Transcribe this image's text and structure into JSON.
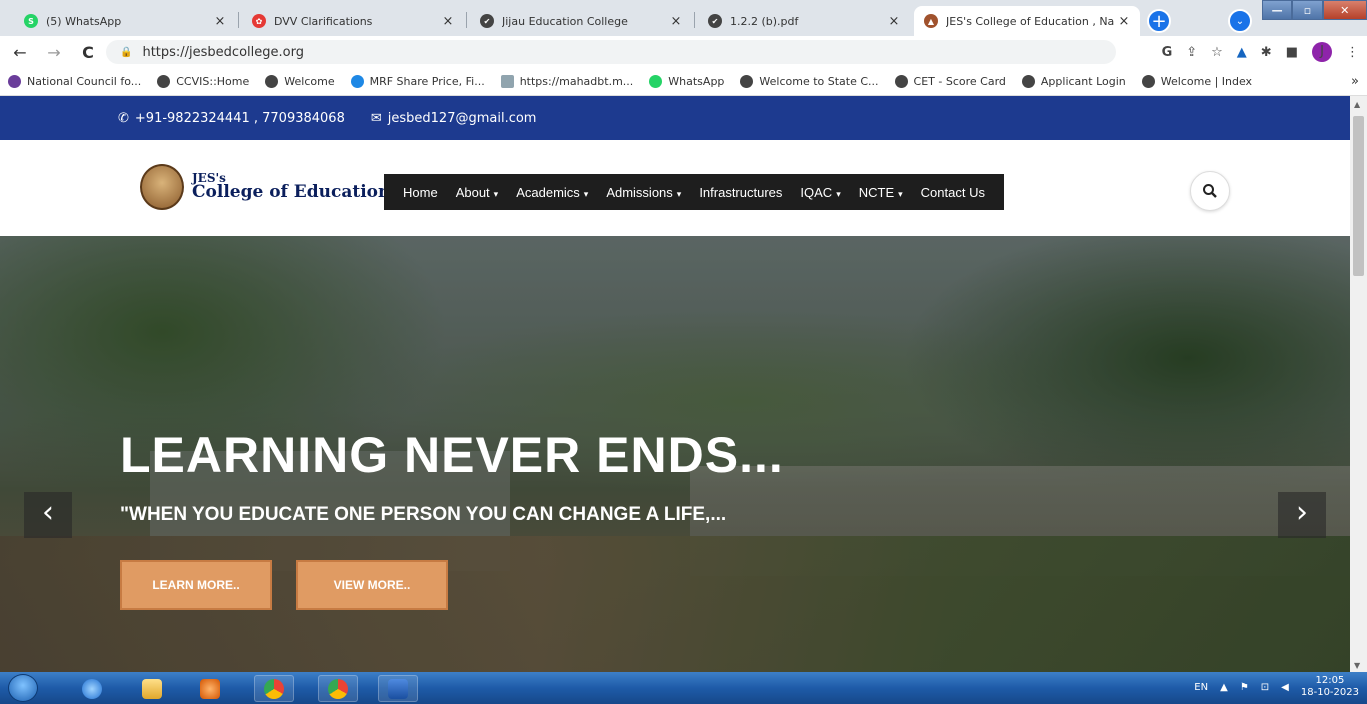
{
  "browser": {
    "tabs": [
      {
        "title": "(5) WhatsApp",
        "icon": "whatsapp-icon",
        "color": "#25d366",
        "glyph": "S"
      },
      {
        "title": "DVV Clarifications",
        "icon": "dvv-icon",
        "color": "#e53935",
        "glyph": "✿"
      },
      {
        "title": "Jijau Education College",
        "icon": "globe-icon",
        "color": "#444444",
        "glyph": "✔"
      },
      {
        "title": "1.2.2 (b).pdf",
        "icon": "globe-icon",
        "color": "#444444",
        "glyph": "✔"
      },
      {
        "title": "JES's College of Education , Na",
        "icon": "college-favicon-icon",
        "color": "#a0522d",
        "glyph": "▲"
      }
    ],
    "close_glyph": "×",
    "new_tab_glyph": "+",
    "tab_search_glyph": "⌄",
    "window_controls": {
      "min": "—",
      "max": "▫",
      "close": "✕"
    },
    "url": "https://jesbedcollege.org",
    "nav": {
      "back": "←",
      "forward": "→",
      "reload": "C"
    },
    "toolbar_icons": {
      "google": "G",
      "share": "⇪",
      "star": "☆",
      "ext": "▲",
      "puzzle": "✱",
      "sidepanel": "■",
      "profile": "J",
      "menu": "⋮"
    },
    "bookmarks": [
      {
        "label": "National Council fo...",
        "color": "#6a3d9a"
      },
      {
        "label": "CCVIS::Home",
        "color": "#333333"
      },
      {
        "label": "Welcome",
        "color": "#333333"
      },
      {
        "label": "MRF Share Price, Fi...",
        "color": "#1e88e5"
      },
      {
        "label": "https://mahadbt.m...",
        "color": "#90a4ae"
      },
      {
        "label": "WhatsApp",
        "color": "#25d366"
      },
      {
        "label": "Welcome to State C...",
        "color": "#333333"
      },
      {
        "label": "CET - Score Card",
        "color": "#333333"
      },
      {
        "label": "Applicant Login",
        "color": "#333333"
      },
      {
        "label": "Welcome | Index",
        "color": "#333333"
      }
    ],
    "bookmarks_more": "»"
  },
  "site": {
    "topbar": {
      "phone_icon": "✆",
      "phone": "+91-9822324441 , 7709384068",
      "mail_icon": "✉",
      "email": "jesbed127@gmail.com"
    },
    "logo": {
      "line1": "JES's",
      "line2": "College of Education"
    },
    "nav": [
      {
        "label": "Home",
        "caret": ""
      },
      {
        "label": "About",
        "caret": "▾"
      },
      {
        "label": "Academics",
        "caret": "▾"
      },
      {
        "label": "Admissions",
        "caret": "▾"
      },
      {
        "label": "Infrastructures",
        "caret": ""
      },
      {
        "label": "IQAC",
        "caret": "▾"
      },
      {
        "label": "NCTE",
        "caret": "▾"
      },
      {
        "label": "Contact Us",
        "caret": ""
      }
    ],
    "search_glyph": "⚲",
    "hero": {
      "title": "LEARNING NEVER ENDS...",
      "subtitle": "\"WHEN YOU EDUCATE ONE PERSON YOU CAN CHANGE A LIFE,...",
      "btn_learn": "LEARN MORE..",
      "btn_view": "VIEW MORE..",
      "prev": "‹",
      "next": "›"
    }
  },
  "taskbar": {
    "apps": [
      "ie-icon",
      "explorer-icon",
      "media-player-icon",
      "chrome-icon",
      "chrome-profile-icon",
      "word-icon"
    ],
    "lang": "EN",
    "tray_up": "▲",
    "flag": "⚑",
    "network": "⊡",
    "volume": "◀",
    "time": "12:05",
    "date": "18-10-2023"
  },
  "colors": {
    "accent_blue": "#1d3a8f",
    "button_orange": "#e09b63",
    "nav_dark": "#1e1e1e"
  }
}
